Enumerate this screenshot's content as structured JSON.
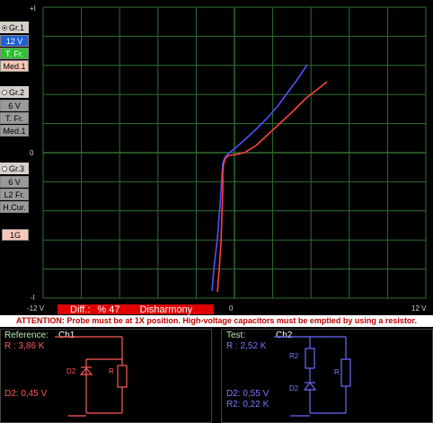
{
  "left_panel": {
    "groups": [
      {
        "radio_label": "Gr.1",
        "selected": true,
        "buttons": [
          {
            "label": "12 V",
            "bg": "#1f5fd6",
            "fg": "#ffffff"
          },
          {
            "label": "T. Fr.",
            "bg": "#2fbf2f",
            "fg": "#ffffff"
          },
          {
            "label": "Med.1",
            "bg": "#f7c8b8",
            "fg": "#000000"
          }
        ]
      },
      {
        "radio_label": "Gr.2",
        "selected": false,
        "buttons": [
          {
            "label": "6 V",
            "bg": "#9a9a9a",
            "fg": "#000000"
          },
          {
            "label": "T. Fr.",
            "bg": "#9a9a9a",
            "fg": "#000000"
          },
          {
            "label": "Med.1",
            "bg": "#9a9a9a",
            "fg": "#000000"
          }
        ]
      },
      {
        "radio_label": "Gr.3",
        "selected": false,
        "buttons": [
          {
            "label": "6 V",
            "bg": "#9a9a9a",
            "fg": "#000000"
          },
          {
            "label": "L2 Fr.",
            "bg": "#9a9a9a",
            "fg": "#000000"
          },
          {
            "label": "H.Cur.",
            "bg": "#9a9a9a",
            "fg": "#000000"
          }
        ]
      }
    ],
    "scale_button": "1G"
  },
  "plot": {
    "y_top": "+I",
    "y_zero": "0",
    "y_bottom": "-I",
    "x_left": "-12 V",
    "x_center": "0",
    "x_right": "12 V",
    "grid_color": "#2f6f2f",
    "blue_color": "#5050ff",
    "red_color": "#ff4040"
  },
  "status": {
    "diff_label": "Diff.:",
    "diff_value": "% 47",
    "result": "Disharmony",
    "bar_color": "#e00000"
  },
  "warning": "ATTENTION: Probe must be at 1X position. High-voltage capacitors must be emptied by using a resistor.",
  "reference": {
    "title": "Reference:",
    "channel": "Ch1",
    "r_text": "R : 3,86 K",
    "d2_text": "D2: 0,45 V",
    "comp_d2": "D2",
    "comp_r": "R"
  },
  "test": {
    "title": "Test:",
    "channel": "Ch2",
    "r_text": "R : 2,52 K",
    "d2_text": "D2: 0,55 V",
    "r2_text": "R2: 0,22 K",
    "comp_r2": "R2",
    "comp_d2": "D2",
    "comp_r": "R"
  }
}
